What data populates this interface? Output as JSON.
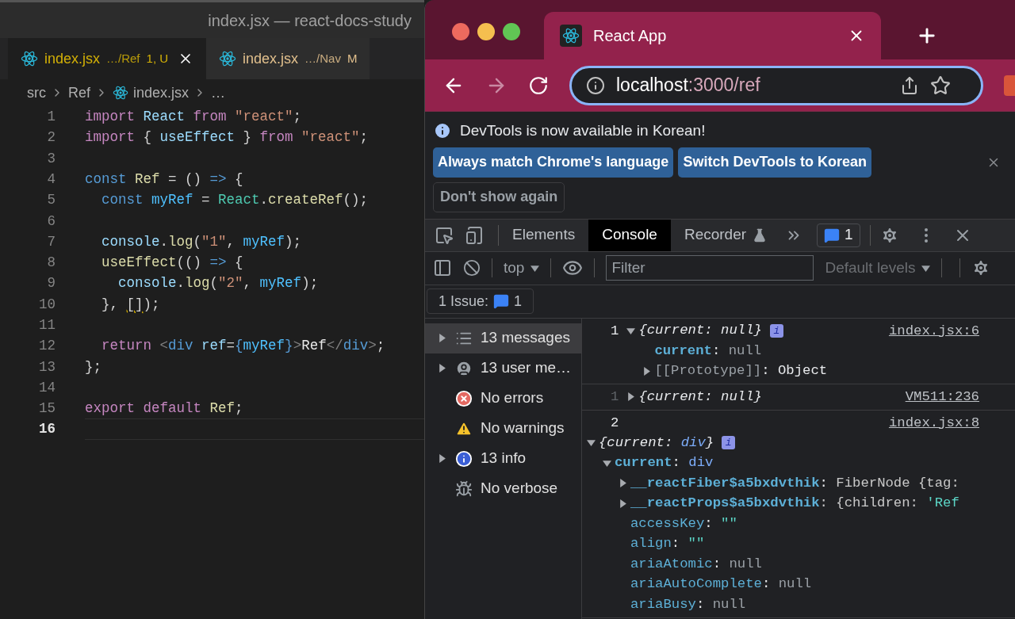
{
  "editor": {
    "window_title": "index.jsx — react-docs-study",
    "tabs": [
      {
        "name": "index.jsx",
        "path": "…/Ref",
        "badge": "1, U",
        "selected": true,
        "color": "#d4b106"
      },
      {
        "name": "index.jsx",
        "path": "…/Nav",
        "badge": "M",
        "selected": false,
        "color": "#e2c08d"
      }
    ],
    "breadcrumb": [
      {
        "text": "src",
        "kind": "folder"
      },
      {
        "text": "Ref",
        "kind": "folder"
      },
      {
        "text": "index.jsx",
        "kind": "file"
      },
      {
        "text": "…",
        "kind": "symbol"
      }
    ],
    "lines": [
      {
        "number": "1",
        "current": false,
        "tokens": [
          {
            "text": "import ",
            "kind": "kw"
          },
          {
            "text": "React ",
            "kind": "var"
          },
          {
            "text": "from ",
            "kind": "kw"
          },
          {
            "text": "\"react\"",
            "kind": "str"
          },
          {
            "text": ";",
            "kind": "punct"
          }
        ]
      },
      {
        "number": "2",
        "current": false,
        "tokens": [
          {
            "text": "import ",
            "kind": "kw"
          },
          {
            "text": "{ ",
            "kind": "punct"
          },
          {
            "text": "useEffect",
            "kind": "var"
          },
          {
            "text": " } ",
            "kind": "punct"
          },
          {
            "text": "from ",
            "kind": "kw"
          },
          {
            "text": "\"react\"",
            "kind": "str"
          },
          {
            "text": ";",
            "kind": "punct"
          }
        ]
      },
      {
        "number": "3",
        "current": false
      },
      {
        "number": "4",
        "current": false,
        "tokens": [
          {
            "text": "const ",
            "kind": "decl"
          },
          {
            "text": "Ref",
            "kind": "fn"
          },
          {
            "text": " = () ",
            "kind": "punct"
          },
          {
            "text": "=>",
            "kind": "decl"
          },
          {
            "text": " {",
            "kind": "punct"
          }
        ]
      },
      {
        "number": "5",
        "current": false,
        "tokens": [
          {
            "text": "  const ",
            "kind": "decl"
          },
          {
            "text": "myRef",
            "kind": "const"
          },
          {
            "text": " = ",
            "kind": "punct"
          },
          {
            "text": "React",
            "kind": "cls"
          },
          {
            "text": ".",
            "kind": "punct"
          },
          {
            "text": "createRef",
            "kind": "fn"
          },
          {
            "text": "();",
            "kind": "punct"
          }
        ]
      },
      {
        "number": "6",
        "current": false
      },
      {
        "number": "7",
        "current": false,
        "tokens": [
          {
            "text": "  console",
            "kind": "var"
          },
          {
            "text": ".",
            "kind": "punct"
          },
          {
            "text": "log",
            "kind": "fn"
          },
          {
            "text": "(",
            "kind": "punct"
          },
          {
            "text": "\"1\"",
            "kind": "str"
          },
          {
            "text": ", ",
            "kind": "punct"
          },
          {
            "text": "myRef",
            "kind": "const"
          },
          {
            "text": ");",
            "kind": "punct"
          }
        ]
      },
      {
        "number": "8",
        "current": false,
        "tokens": [
          {
            "text": "  useEffect",
            "kind": "fn"
          },
          {
            "text": "(() ",
            "kind": "punct"
          },
          {
            "text": "=>",
            "kind": "decl"
          },
          {
            "text": " {",
            "kind": "punct"
          }
        ]
      },
      {
        "number": "9",
        "current": false,
        "tokens": [
          {
            "text": "    console",
            "kind": "var"
          },
          {
            "text": ".",
            "kind": "punct"
          },
          {
            "text": "log",
            "kind": "fn"
          },
          {
            "text": "(",
            "kind": "punct"
          },
          {
            "text": "\"2\"",
            "kind": "str"
          },
          {
            "text": ", ",
            "kind": "punct"
          },
          {
            "text": "myRef",
            "kind": "const"
          },
          {
            "text": ");",
            "kind": "punct"
          }
        ]
      },
      {
        "number": "10",
        "current": false,
        "tokens": [
          {
            "text": "  }, ",
            "kind": "punct"
          },
          {
            "text": "[]",
            "kind": "warn"
          },
          {
            "text": ");",
            "kind": "punct"
          }
        ]
      },
      {
        "number": "11",
        "current": false
      },
      {
        "number": "12",
        "current": false,
        "tokens": [
          {
            "text": "  return ",
            "kind": "kw"
          },
          {
            "text": "<",
            "kind": "tag"
          },
          {
            "text": "div ",
            "kind": "decl"
          },
          {
            "text": "ref",
            "kind": "var"
          },
          {
            "text": "=",
            "kind": "punct"
          },
          {
            "text": "{",
            "kind": "decl"
          },
          {
            "text": "myRef",
            "kind": "const"
          },
          {
            "text": "}",
            "kind": "decl"
          },
          {
            "text": ">",
            "kind": "tag"
          },
          {
            "text": "Ref",
            "kind": "text"
          },
          {
            "text": "</",
            "kind": "tag"
          },
          {
            "text": "div",
            "kind": "decl"
          },
          {
            "text": ">",
            "kind": "tag"
          },
          {
            "text": ";",
            "kind": "punct"
          }
        ]
      },
      {
        "number": "13",
        "current": false,
        "tokens": [
          {
            "text": "};",
            "kind": "punct"
          }
        ]
      },
      {
        "number": "14",
        "current": false
      },
      {
        "number": "15",
        "current": false,
        "tokens": [
          {
            "text": "export default ",
            "kind": "kw"
          },
          {
            "text": "Ref",
            "kind": "fn"
          },
          {
            "text": ";",
            "kind": "punct"
          }
        ]
      },
      {
        "number": "16",
        "current": true
      }
    ]
  },
  "browser": {
    "tab": {
      "title": "React App"
    },
    "address": {
      "host": "localhost",
      "rest": ":3000/ref"
    },
    "forward_disabled": true,
    "infobar": {
      "message": "DevTools is now available in Korean!",
      "buttons": [
        "Always match Chrome's language",
        "Switch DevTools to Korean"
      ],
      "dismiss": "Don't show again"
    },
    "devtools": {
      "tabs": [
        {
          "label": "Elements",
          "selected": false
        },
        {
          "label": "Console",
          "selected": true
        },
        {
          "label": "Recorder",
          "selected": false
        }
      ],
      "issues_count": "1",
      "context": "top",
      "filter": {
        "placeholder": "Filter"
      },
      "levels": "Default levels",
      "issue_bar": {
        "label": "1 Issue:",
        "count": "1"
      },
      "sidebar": [
        {
          "label": "13 messages",
          "kind": "list",
          "expandable": true,
          "selected": true
        },
        {
          "label": "13 user me…",
          "kind": "user",
          "expandable": true,
          "selected": false
        },
        {
          "label": "No errors",
          "kind": "error",
          "expandable": false,
          "selected": false
        },
        {
          "label": "No warnings",
          "kind": "warning",
          "expandable": false,
          "selected": false
        },
        {
          "label": "13 info",
          "kind": "info",
          "expandable": true,
          "selected": false
        },
        {
          "label": "No verbose",
          "kind": "verbose",
          "expandable": false,
          "selected": false
        }
      ],
      "messages": [
        {
          "text": "1",
          "dimmed": false,
          "inline": true,
          "source": "index.jsx:6",
          "node": {
            "expanded": true,
            "preview": true,
            "badge": "i",
            "tokens": [
              {
                "text": "{current: null}",
                "kind": "text"
              }
            ],
            "children": [
              {
                "tokens": [
                  {
                    "text": "current",
                    "kind": "key"
                  },
                  {
                    "text": ": ",
                    "kind": "text"
                  },
                  {
                    "text": "null",
                    "kind": "null"
                  }
                ]
              },
              {
                "expanded": false,
                "tokens": [
                  {
                    "text": "[[Prototype]]",
                    "kind": "null"
                  },
                  {
                    "text": ": Object",
                    "kind": "text"
                  }
                ]
              }
            ]
          }
        },
        {
          "text": "1",
          "dimmed": true,
          "inline": true,
          "source": "VM511:236",
          "node": {
            "expanded": false,
            "preview": true,
            "tokens": [
              {
                "text": "{current: null}",
                "kind": "text"
              }
            ]
          }
        },
        {
          "text": "2",
          "dimmed": false,
          "inline": false,
          "source": "index.jsx:8",
          "node": {
            "expanded": true,
            "preview": true,
            "badge": "i",
            "tokens": [
              {
                "text": "{current: ",
                "kind": "text"
              },
              {
                "text": "div",
                "kind": "node"
              },
              {
                "text": "}",
                "kind": "text"
              }
            ],
            "children": [
              {
                "expanded": true,
                "tokens": [
                  {
                    "text": "current",
                    "kind": "key"
                  },
                  {
                    "text": ": ",
                    "kind": "text"
                  },
                  {
                    "text": "div",
                    "kind": "node"
                  }
                ],
                "children": [
                  {
                    "expanded": false,
                    "tokens": [
                      {
                        "text": "__reactFiber$a5bxdvthik",
                        "kind": "key"
                      },
                      {
                        "text": ": ",
                        "kind": "text"
                      },
                      {
                        "text": "FiberNode {tag:",
                        "kind": "plain"
                      }
                    ]
                  },
                  {
                    "expanded": false,
                    "tokens": [
                      {
                        "text": "__reactProps$a5bxdvthik",
                        "kind": "key"
                      },
                      {
                        "text": ": {children: ",
                        "kind": "plain"
                      },
                      {
                        "text": "'Ref",
                        "kind": "string"
                      }
                    ]
                  },
                  {
                    "tokens": [
                      {
                        "text": "accessKey",
                        "kind": "prop"
                      },
                      {
                        "text": ": ",
                        "kind": "text"
                      },
                      {
                        "text": "\"\"",
                        "kind": "string"
                      }
                    ]
                  },
                  {
                    "tokens": [
                      {
                        "text": "align",
                        "kind": "prop"
                      },
                      {
                        "text": ": ",
                        "kind": "text"
                      },
                      {
                        "text": "\"\"",
                        "kind": "string"
                      }
                    ]
                  },
                  {
                    "tokens": [
                      {
                        "text": "ariaAtomic",
                        "kind": "prop"
                      },
                      {
                        "text": ": ",
                        "kind": "text"
                      },
                      {
                        "text": "null",
                        "kind": "null"
                      }
                    ]
                  },
                  {
                    "tokens": [
                      {
                        "text": "ariaAutoComplete",
                        "kind": "prop"
                      },
                      {
                        "text": ": ",
                        "kind": "text"
                      },
                      {
                        "text": "null",
                        "kind": "null"
                      }
                    ]
                  },
                  {
                    "tokens": [
                      {
                        "text": "ariaBusy",
                        "kind": "prop"
                      },
                      {
                        "text": ": ",
                        "kind": "text"
                      },
                      {
                        "text": "null",
                        "kind": "null"
                      }
                    ]
                  }
                ]
              }
            ]
          }
        }
      ]
    }
  }
}
